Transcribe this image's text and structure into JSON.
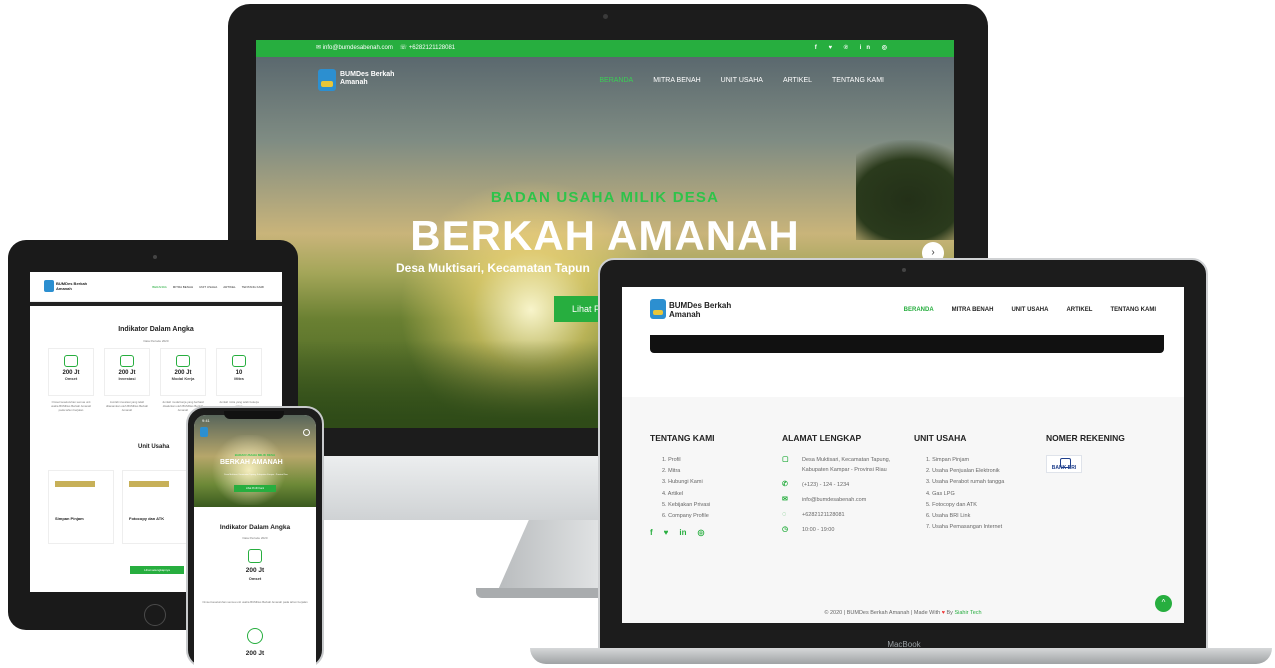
{
  "imac": {
    "email": "info@bumdesabenah.com",
    "phone": "+6282121128081",
    "social": "f ♥ ℗ in ◎",
    "brand": "BUMDes Berkah Amanah",
    "nav": [
      "BERANDA",
      "MITRA BENAH",
      "UNIT USAHA",
      "ARTIKEL",
      "TENTANG KAMI"
    ],
    "hero_subtitle": "BADAN USAHA MILIK DESA",
    "hero_title": "BERKAH AMANAH",
    "hero_location": "Desa Muktisari, Kecamatan Tapun",
    "hero_button": "Lihat P",
    "next_arrow": "›"
  },
  "tablet": {
    "brand": "BUMDes Berkah Amanah",
    "nav": [
      "BERANDA",
      "MITRA BENAH",
      "UNIT USAHA",
      "ARTIKEL",
      "TENTANG KAMI"
    ],
    "section_title": "Indikator Dalam Angka",
    "section_sub": "Data Periode 2020",
    "stats": [
      {
        "value": "200 Jt",
        "label": "Omset",
        "desc": "Omset keseluruhan semua unit usaha BUMDes Berkah Amanah pada tahun berjalan"
      },
      {
        "value": "200 Jt",
        "label": "Investasi",
        "desc": "Jumlah investasi yang telah ditanamkan oleh BUMDes Berkah Amanah"
      },
      {
        "value": "200 Jt",
        "label": "Modal Kerja",
        "desc": "Jumlah modal kerja yang berhasil disalurkan oleh BUMDes Berkah Amanah"
      },
      {
        "value": "10",
        "label": "Mitra",
        "desc": "Jumlah mitra yang telah bekerja sama"
      }
    ],
    "units_title": "Unit Usaha",
    "units": [
      {
        "name": "Simpan Pinjam"
      },
      {
        "name": "Fotocopy dan ATK"
      }
    ],
    "button": "Lihat selengkapnya"
  },
  "phone": {
    "time": "9:41",
    "hero_sub": "BADAN USAHA MILIK DESA",
    "hero_title": "BERKAH AMANAH",
    "hero_loc": "Desa Muktisari, Kecamatan Tapung, Kabupaten Kampar - Provinsi Riau",
    "hero_button": "Lihat Profil Kami",
    "section_title": "Indikator Dalam Angka",
    "section_sub": "Data Periode 2020",
    "value1": "200 Jt",
    "label1": "Omset",
    "desc1": "Omset keseluruhan semua unit usaha BUMDes Berkah Amanah pada tahun berjalan",
    "value2": "200 Jt"
  },
  "macbook": {
    "label": "MacBook",
    "brand": "BUMDes Berkah Amanah",
    "nav": [
      "BERANDA",
      "MITRA BENAH",
      "UNIT USAHA",
      "ARTIKEL",
      "TENTANG KAMI"
    ],
    "footer": {
      "about_title": "TENTANG KAMI",
      "about_links": [
        "1. Profil",
        "2. Mitra",
        "3. Hubungi Kami",
        "4. Artikel",
        "5. Kebijakan Privasi",
        "6. Company Profile"
      ],
      "social": [
        "f",
        "♥",
        "in",
        "◎"
      ],
      "address_title": "ALAMAT LENGKAP",
      "address": "Desa Muktisari, Kecamatan Tapung, Kabupaten Kampar - Provinsi Riau",
      "phone": "(+123) - 124 - 1234",
      "email": "info@bumdesabenah.com",
      "whatsapp": "+6282121128081",
      "hours": "10:00 - 19:00",
      "units_title": "UNIT USAHA",
      "units": [
        "1. Simpan Pinjam",
        "2. Usaha Penjualan Elektronik",
        "3. Usaha Perabot rumah tangga",
        "4. Gas LPG",
        "5. Fotocopy dan ATK",
        "6. Usaha BRI Link",
        "7. Usaha Pemasangan Internet"
      ],
      "bank_title": "NOMER REKENING",
      "bank_name": "BANK BRI",
      "copyright_pre": "© 2020 | BUMDes Berkah Amanah | Made With",
      "heart": "♥",
      "copyright_by": "By",
      "author": "Siahir Tech"
    },
    "scroll_top": "^"
  },
  "colors": {
    "accent": "#27ae3f",
    "dark": "#1c1c1c"
  }
}
